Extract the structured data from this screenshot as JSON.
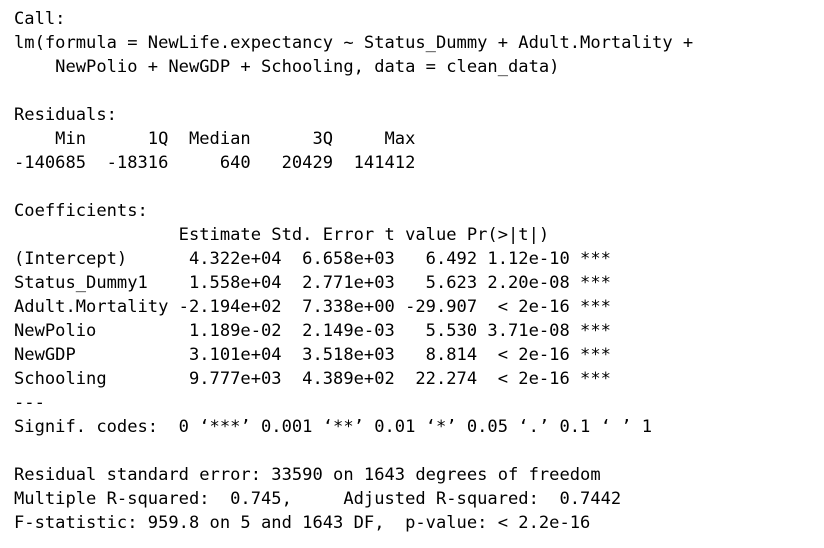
{
  "call": {
    "header": "Call:",
    "line1": "lm(formula = NewLife.expectancy ~ Status_Dummy + Adult.Mortality +",
    "line2": "    NewPolio + NewGDP + Schooling, data = clean_data)"
  },
  "residuals": {
    "header": "Residuals:",
    "columns": "    Min      1Q  Median      3Q     Max",
    "values": "-140685  -18316     640   20429  141412"
  },
  "coefficients": {
    "header": "Coefficients:",
    "columns": "                Estimate Std. Error t value Pr(>|t|)    ",
    "rows": [
      "(Intercept)      4.322e+04  6.658e+03   6.492 1.12e-10 ***",
      "Status_Dummy1    1.558e+04  2.771e+03   5.623 2.20e-08 ***",
      "Adult.Mortality -2.194e+02  7.338e+00 -29.907  < 2e-16 ***",
      "NewPolio         1.189e-02  2.149e-03   5.530 3.71e-08 ***",
      "NewGDP           3.101e+04  3.518e+03   8.814  < 2e-16 ***",
      "Schooling        9.777e+03  4.389e+02  22.274  < 2e-16 ***"
    ],
    "separator": "---",
    "signif_codes": "Signif. codes:  0 ‘***’ 0.001 ‘**’ 0.01 ‘*’ 0.05 ‘.’ 0.1 ‘ ’ 1"
  },
  "summary": {
    "rse": "Residual standard error: 33590 on 1643 degrees of freedom",
    "r_squared": "Multiple R-squared:  0.745,\tAdjusted R-squared:  0.7442 ",
    "f_statistic": "F-statistic: 959.8 on 5 and 1643 DF,  p-value: < 2.2e-16"
  }
}
